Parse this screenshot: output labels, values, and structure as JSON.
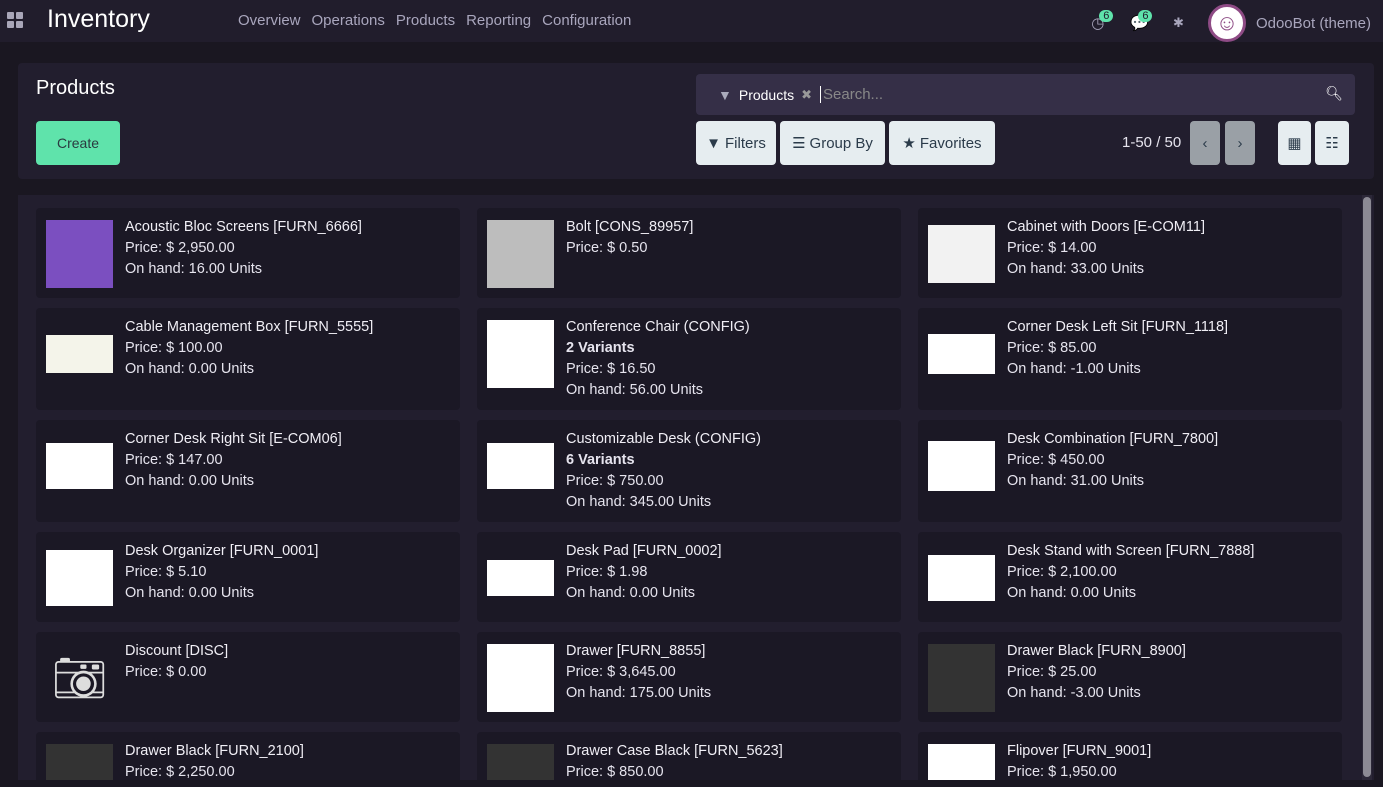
{
  "nav": {
    "app": "Inventory",
    "menu": [
      "Overview",
      "Operations",
      "Products",
      "Reporting",
      "Configuration"
    ],
    "activity_count": "6",
    "message_count": "6",
    "user": "OdooBot (theme)"
  },
  "control": {
    "title": "Products",
    "create": "Create",
    "facet": "Products",
    "search_placeholder": "Search...",
    "filters": "Filters",
    "group_by": "Group By",
    "favorites": "Favorites",
    "pager": "1-50 / 50"
  },
  "products": [
    {
      "name": "Acoustic Bloc Screens [FURN_6666]",
      "price": "Price: $ 2,950.00",
      "onhand": "On hand: 16.00 Units",
      "color": "#7b4fc0",
      "h": 68
    },
    {
      "name": "Bolt [CONS_89957]",
      "price": "Price: $ 0.50",
      "onhand": "",
      "color": "#bdbdbd",
      "h": 68
    },
    {
      "name": "Cabinet with Doors [E-COM11]",
      "price": "Price: $ 14.00",
      "onhand": "On hand: 33.00 Units",
      "color": "#f2f2f2",
      "h": 58
    },
    {
      "name": "Cable Management Box [FURN_5555]",
      "price": "Price: $ 100.00",
      "onhand": "On hand: 0.00 Units",
      "color": "#f4f4ea",
      "h": 38
    },
    {
      "name": "Conference Chair (CONFIG)",
      "variants": "2 Variants",
      "price": "Price: $ 16.50",
      "onhand": "On hand: 56.00 Units",
      "color": "#ffffff",
      "h": 68
    },
    {
      "name": "Corner Desk Left Sit [FURN_1118]",
      "price": "Price: $ 85.00",
      "onhand": "On hand: -1.00 Units",
      "color": "#fff",
      "h": 40
    },
    {
      "name": "Corner Desk Right Sit [E-COM06]",
      "price": "Price: $ 147.00",
      "onhand": "On hand: 0.00 Units",
      "color": "#fff",
      "h": 46
    },
    {
      "name": "Customizable Desk (CONFIG)",
      "variants": "6 Variants",
      "price": "Price: $ 750.00",
      "onhand": "On hand: 345.00 Units",
      "color": "#fff",
      "h": 46
    },
    {
      "name": "Desk Combination [FURN_7800]",
      "price": "Price: $ 450.00",
      "onhand": "On hand: 31.00 Units",
      "color": "#fff",
      "h": 50
    },
    {
      "name": "Desk Organizer [FURN_0001]",
      "price": "Price: $ 5.10",
      "onhand": "On hand: 0.00 Units",
      "color": "#fff",
      "h": 56
    },
    {
      "name": "Desk Pad [FURN_0002]",
      "price": "Price: $ 1.98",
      "onhand": "On hand: 0.00 Units",
      "color": "#fff",
      "h": 36
    },
    {
      "name": "Desk Stand with Screen [FURN_7888]",
      "price": "Price: $ 2,100.00",
      "onhand": "On hand: 0.00 Units",
      "color": "#fff",
      "h": 46
    },
    {
      "name": "Discount [DISC]",
      "price": "Price: $ 0.00",
      "onhand": "",
      "camera": true
    },
    {
      "name": "Drawer [FURN_8855]",
      "price": "Price: $ 3,645.00",
      "onhand": "On hand: 175.00 Units",
      "color": "#fff",
      "h": 68
    },
    {
      "name": "Drawer Black [FURN_8900]",
      "price": "Price: $ 25.00",
      "onhand": "On hand: -3.00 Units",
      "color": "#333",
      "h": 68
    },
    {
      "name": "Drawer Black [FURN_2100]",
      "price": "Price: $ 2,250.00",
      "onhand": "",
      "color": "#333",
      "h": 68
    },
    {
      "name": "Drawer Case Black [FURN_5623]",
      "price": "Price: $ 850.00",
      "onhand": "",
      "color": "#333",
      "h": 68
    },
    {
      "name": "Flipover [FURN_9001]",
      "price": "Price: $ 1,950.00",
      "onhand": "",
      "color": "#fff",
      "h": 68
    }
  ]
}
